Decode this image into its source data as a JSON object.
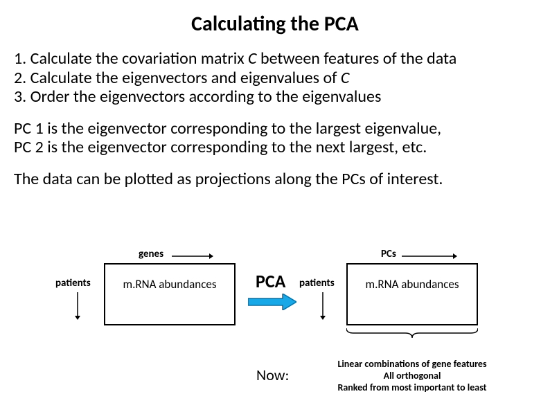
{
  "title": "Calculating the PCA",
  "steps": {
    "s1a": "1. Calculate the covariation matrix ",
    "s1b": "C",
    "s1c": " between features of the data",
    "s2a": "2. Calculate the eigenvectors and eigenvalues of ",
    "s2b": "C",
    "s3": "3. Order the eigenvectors according to the eigenvalues"
  },
  "para2": {
    "l1": "PC 1 is the eigenvector corresponding to the largest eigenvalue,",
    "l2": "PC 2 is the eigenvector corresponding to the next largest, etc."
  },
  "para3": "The data can be plotted as projections along the PCs of interest.",
  "diagram": {
    "genes": "genes",
    "pcs": "PCs",
    "patients": "patients",
    "box_left": "m.RNA abundances",
    "box_right": "m.RNA abundances",
    "pca": "PCA",
    "now": "Now:",
    "footer": {
      "l1": "Linear combinations of gene features",
      "l2": "All orthogonal",
      "l3": "Ranked from most important to least"
    }
  }
}
